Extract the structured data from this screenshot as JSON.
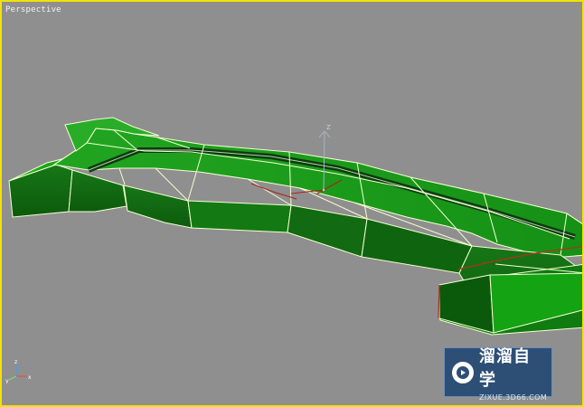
{
  "viewport": {
    "label": "Perspective",
    "border_color": "#f2e200",
    "background_color": "#8f8f8f"
  },
  "scene": {
    "object_color": "#1f9a1f",
    "object_shadow_color": "#0f5b0f",
    "edge_color": "#f4ffd0",
    "gizmo_color": "#9ba6b0",
    "gizmo_active_color": "#b21e1e",
    "gizmo_axis_label": "Z"
  },
  "axis_tripod": {
    "x_label": "x",
    "y_label": "y",
    "z_label": "z"
  },
  "watermark": {
    "title": "溜溜自学",
    "subtitle": "ZIXUE.3D66.COM",
    "icon": "play-icon"
  }
}
